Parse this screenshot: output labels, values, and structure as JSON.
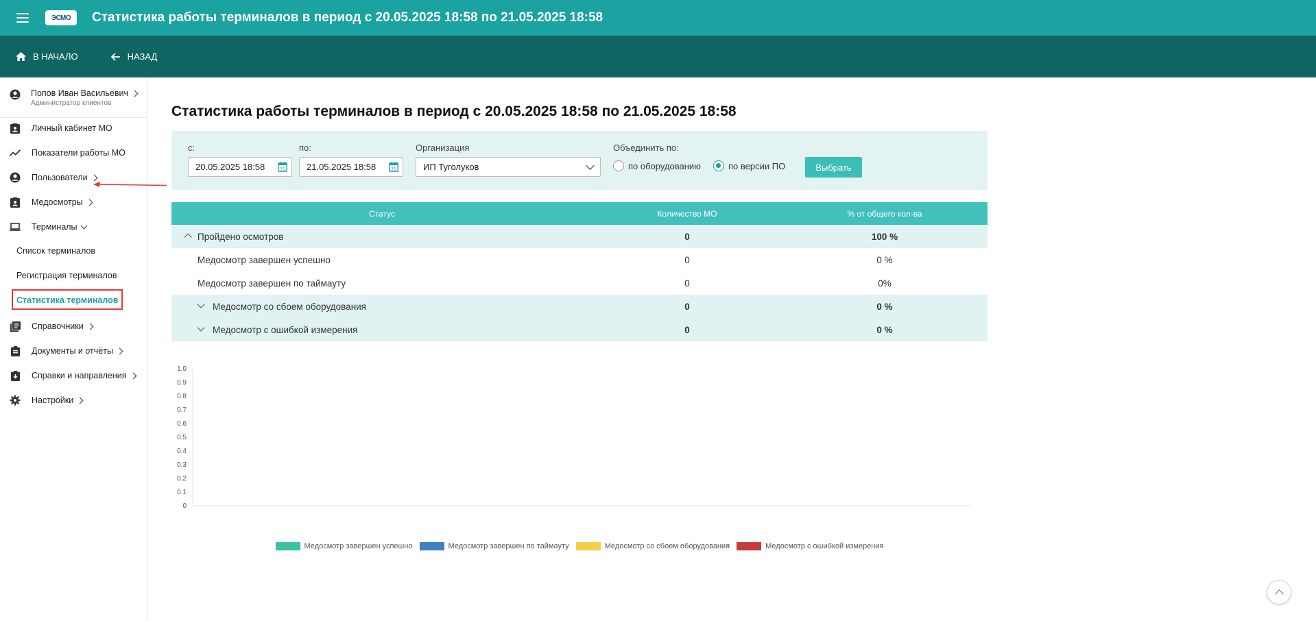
{
  "header": {
    "logo_text": "ЭСМО",
    "title": "Статистика работы терминалов в период с 20.05.2025 18:58 по 21.05.2025 18:58"
  },
  "nav": {
    "home": "В НАЧАЛО",
    "back": "НАЗАД"
  },
  "sidebar": {
    "user": {
      "name": "Попов Иван Васильевич",
      "role": "Администратор клиентов"
    },
    "items": [
      {
        "label": "Личный кабинет МО",
        "icon": "badge-icon"
      },
      {
        "label": "Показатели работы МО",
        "icon": "trend-icon"
      },
      {
        "label": "Пользователи",
        "icon": "user-icon"
      },
      {
        "label": "Медосмотры",
        "icon": "badge-icon"
      },
      {
        "label": "Терминалы",
        "icon": "laptop-icon"
      },
      {
        "label": "Справочники",
        "icon": "books-icon"
      },
      {
        "label": "Документы и отчёты",
        "icon": "clipboard-icon"
      },
      {
        "label": "Справки и направления",
        "icon": "clipboard-download-icon"
      },
      {
        "label": "Настройки",
        "icon": "gear-icon"
      }
    ],
    "sub_items": [
      "Список терминалов",
      "Регистрация терминалов",
      "Статистика терминалов"
    ]
  },
  "page": {
    "title": "Статистика работы терминалов в период с 20.05.2025 18:58 по 21.05.2025 18:58"
  },
  "filter": {
    "from_label": "с:",
    "from_value": "20.05.2025 18:58",
    "to_label": "по:",
    "to_value": "21.05.2025 18:58",
    "org_label": "Организация",
    "org_value": "ИП Туголуков",
    "group_label": "Объединить по:",
    "radio_equipment": "по оборудованию",
    "radio_version": "по версии ПО",
    "select_button": "Выбрать"
  },
  "table": {
    "headers": [
      "Статус",
      "Количество МО",
      "% от общего кол-ва"
    ],
    "rows": [
      {
        "status": "Пройдено осмотров",
        "count": "0",
        "pct": "100 %"
      },
      {
        "status": "Медосмотр завершен успешно",
        "count": "0",
        "pct": "0 %"
      },
      {
        "status": "Медосмотр завершен по таймауту",
        "count": "0",
        "pct": "0%"
      },
      {
        "status": "Медосмотр со сбоем оборудования",
        "count": "0",
        "pct": "0 %"
      },
      {
        "status": "Медосмотр с ошибкой измерения",
        "count": "0",
        "pct": "0 %"
      }
    ]
  },
  "chart_data": {
    "type": "bar",
    "categories": [],
    "series": [
      {
        "name": "Медосмотр завершен успешно",
        "values": [],
        "color": "#3dbfa8"
      },
      {
        "name": "Медосмотр завершен по таймауту",
        "values": [],
        "color": "#3d7fc1"
      },
      {
        "name": "Медосмотр со сбоем оборудования",
        "values": [],
        "color": "#f6cf4a"
      },
      {
        "name": "Медосмотр с ошибкой измерения",
        "values": [],
        "color": "#c63b3b"
      }
    ],
    "ylim": [
      0,
      1.0
    ],
    "yticks": [
      "0",
      "0.1",
      "0.2",
      "0.3",
      "0.4",
      "0.5",
      "0.6",
      "0.7",
      "0.8",
      "0.9",
      "1.0"
    ],
    "legend": "bottom"
  },
  "colors": {
    "primary": "#1aa3a1",
    "nav": "#106563",
    "table_header": "#41c0bc",
    "row_alt": "#e0f2f1"
  }
}
